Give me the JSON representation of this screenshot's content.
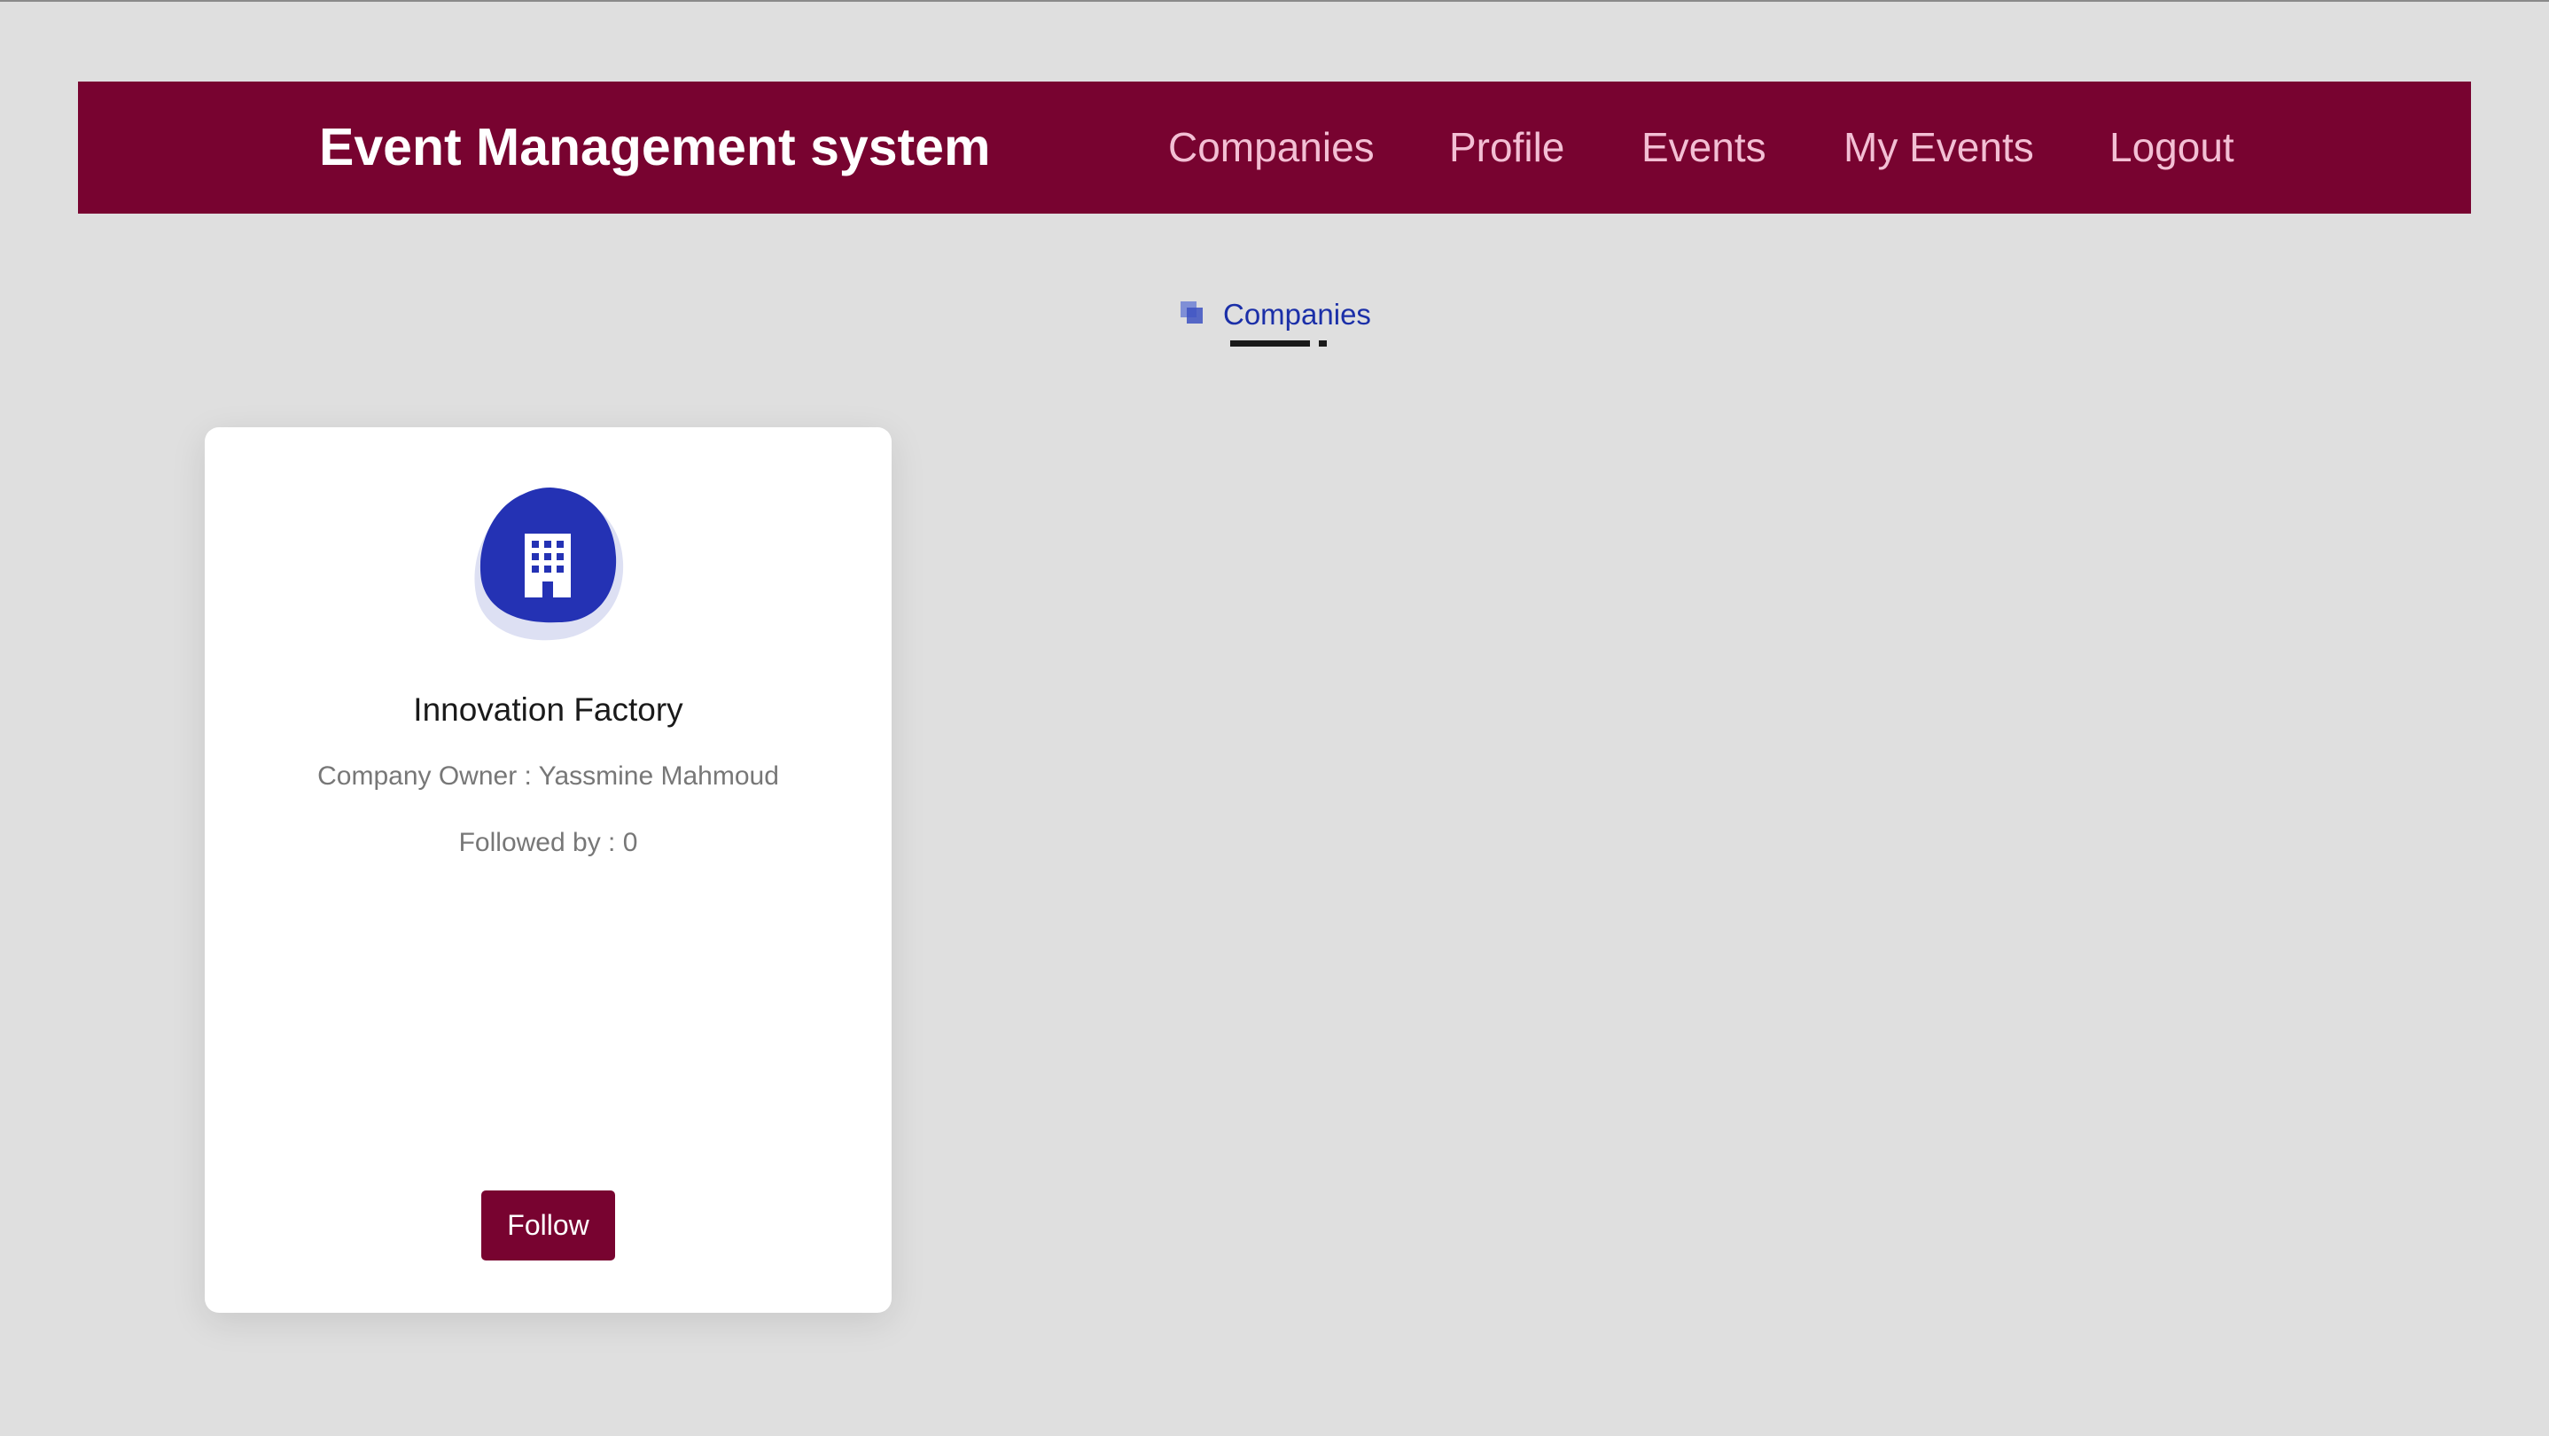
{
  "navbar": {
    "brand": "Event Management system",
    "links": [
      {
        "label": "Companies"
      },
      {
        "label": "Profile"
      },
      {
        "label": "Events"
      },
      {
        "label": "My Events"
      },
      {
        "label": "Logout"
      }
    ]
  },
  "section": {
    "title": "Companies",
    "icon": "stacked-squares-icon"
  },
  "cards": [
    {
      "icon": "building-icon",
      "name": "Innovation Factory",
      "owner_text": "Company Owner : Yassmine Mahmoud",
      "followers_text": "Followed by : 0",
      "follow_label": "Follow"
    }
  ],
  "colors": {
    "navbar_bg": "#780330",
    "nav_link": "#f3bfd4",
    "accent_blue": "#2432b4",
    "page_bg": "#dfdfdf"
  }
}
